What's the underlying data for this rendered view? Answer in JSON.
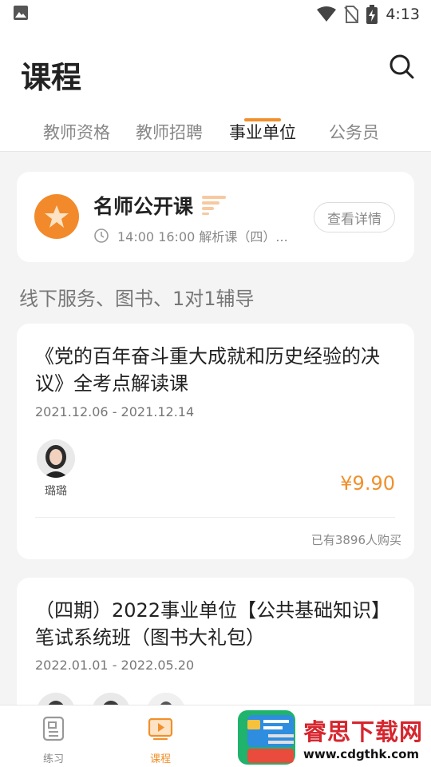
{
  "status_bar": {
    "time": "4:13",
    "icons": [
      "image-icon",
      "wifi-icon",
      "no-sim-icon",
      "battery-charging-icon"
    ]
  },
  "header": {
    "title": "课程",
    "search_icon": "search-icon"
  },
  "tabs": [
    {
      "label": "教师资格",
      "active": false
    },
    {
      "label": "教师招聘",
      "active": false
    },
    {
      "label": "事业单位",
      "active": true
    },
    {
      "label": "公务员",
      "active": false
    }
  ],
  "promo": {
    "title": "名师公开课",
    "icon": "star-icon",
    "schedule": "14:00 16:00 解析课（四）...",
    "detail_button": "查看详情"
  },
  "section_title": "线下服务、图书、1对1辅导",
  "courses": [
    {
      "title": "《党的百年奋斗重大成就和历史经验的决议》全考点解读课",
      "date": "2021.12.06 - 2021.12.14",
      "teachers": [
        {
          "name": "璐璐"
        }
      ],
      "price": "¥9.90",
      "buyers": "已有3896人购买"
    },
    {
      "title": "（四期）2022事业单位【公共基础知识】笔试系统班（图书大礼包）",
      "date": "2022.01.01 - 2022.05.20"
    }
  ],
  "bottom_nav": [
    {
      "label": "练习",
      "icon": "practice-icon",
      "active": false
    },
    {
      "label": "课程",
      "icon": "course-icon",
      "active": true
    }
  ],
  "watermark": {
    "name": "睿思下载网",
    "url": "www.cdgthk.com"
  },
  "colors": {
    "accent": "#f0902c",
    "watermark_red": "#d6262e"
  }
}
